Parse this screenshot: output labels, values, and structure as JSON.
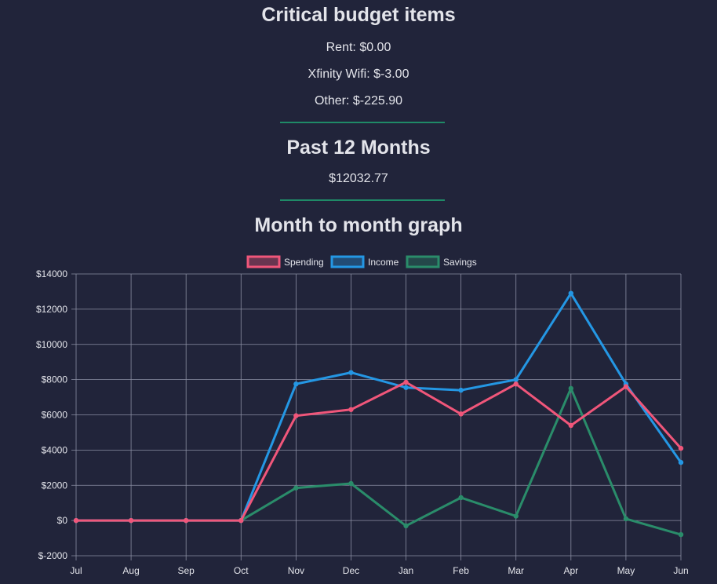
{
  "critical": {
    "title": "Critical budget items",
    "items": [
      "Rent: $0.00",
      "Xfinity Wifi: $-3.00",
      "Other: $-225.90"
    ]
  },
  "past": {
    "title": "Past 12 Months",
    "amount": "$12032.77"
  },
  "graph": {
    "title": "Month to month graph"
  },
  "colors": {
    "background": "#21243a",
    "spending": "#f0567a",
    "income": "#2497e4",
    "savings": "#2a8c6a",
    "divider": "#1f8a67",
    "grid": "#8b8ea3"
  },
  "chart_data": {
    "type": "line",
    "categories": [
      "Jul",
      "Aug",
      "Sep",
      "Oct",
      "Nov",
      "Dec",
      "Jan",
      "Feb",
      "Mar",
      "Apr",
      "May",
      "Jun"
    ],
    "series": [
      {
        "name": "Spending",
        "values": [
          0,
          0,
          0,
          0,
          5950,
          6300,
          7850,
          6050,
          7750,
          5400,
          7600,
          4100
        ]
      },
      {
        "name": "Income",
        "values": [
          0,
          0,
          0,
          0,
          7750,
          8400,
          7550,
          7400,
          8000,
          12900,
          7750,
          3300
        ]
      },
      {
        "name": "Savings",
        "values": [
          0,
          0,
          0,
          0,
          1850,
          2100,
          -300,
          1300,
          250,
          7500,
          100,
          -800
        ]
      }
    ],
    "y_ticks": [
      "$14000",
      "$12000",
      "$10000",
      "$8000",
      "$6000",
      "$4000",
      "$2000",
      "$0",
      "$-2000"
    ],
    "ylim": [
      -2000,
      14000
    ],
    "grid": true,
    "legend_position": "top-center"
  }
}
